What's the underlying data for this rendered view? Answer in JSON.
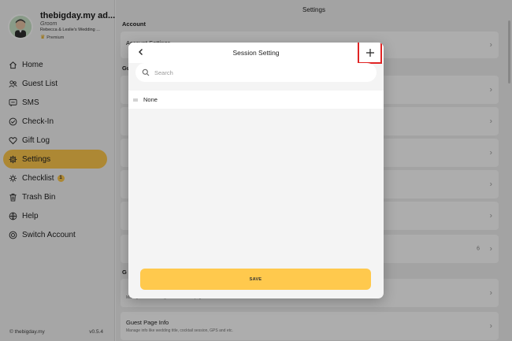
{
  "profile": {
    "name": "thebigday.my ad...",
    "role": "Groom",
    "wedding": "Rebecca & Leslie's Wedding ...",
    "premium": "Premium"
  },
  "nav": {
    "items": [
      {
        "label": "Home",
        "icon": "home-icon"
      },
      {
        "label": "Guest List",
        "icon": "users-icon"
      },
      {
        "label": "SMS",
        "icon": "message-icon"
      },
      {
        "label": "Check-In",
        "icon": "check-in-icon"
      },
      {
        "label": "Gift Log",
        "icon": "heart-icon"
      },
      {
        "label": "Settings",
        "icon": "gear-icon",
        "active": true
      },
      {
        "label": "Checklist",
        "icon": "checklist-icon",
        "badge": "1"
      },
      {
        "label": "Trash Bin",
        "icon": "trash-icon"
      },
      {
        "label": "Help",
        "icon": "help-icon"
      },
      {
        "label": "Switch Account",
        "icon": "switch-icon"
      }
    ]
  },
  "footer": {
    "copyright": "© thebigday.my",
    "version": "v0.5.4"
  },
  "main": {
    "title": "Settings",
    "section_account": "Account",
    "row_account_settings": "Account Settings",
    "section_guest_short": "Gu",
    "section_guest_page_short": "G",
    "row_count": "6",
    "row_bottom_desc_partial": "Manage other wedding details on SEO page.",
    "row_guest_page_info": "Guest Page Info",
    "row_guest_page_info_desc": "Manage info like wedding title, cocktail session, GPS and etc."
  },
  "modal": {
    "title": "Session Setting",
    "search_placeholder": "Search",
    "items": [
      "None"
    ],
    "save_label": "SAVE"
  },
  "colors": {
    "accent": "#ffc94d",
    "highlight": "#e02424"
  }
}
